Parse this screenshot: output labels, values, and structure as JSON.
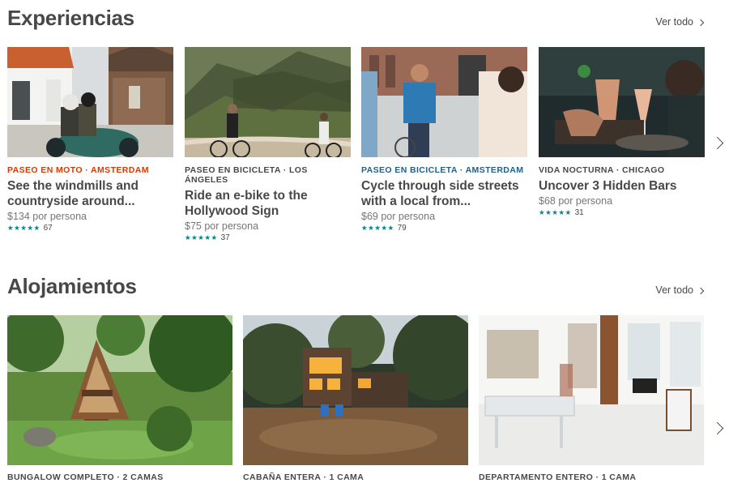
{
  "experiences": {
    "title": "Experiencias",
    "see_all": "Ver todo",
    "cards": [
      {
        "category": "PASEO EN MOTO · AMSTERDAM",
        "category_color": "#D93900",
        "title_line1": "See the windmills and",
        "title_line2": "countryside around...",
        "price": "$134 por persona",
        "stars": "★★★★★",
        "reviews": "67"
      },
      {
        "category": "PASEO EN BICICLETA · LOS ÁNGELES",
        "category_color": "#484848",
        "title_line1": "Ride an e-bike to the",
        "title_line2": "Hollywood Sign",
        "price": "$75 por persona",
        "stars": "★★★★★",
        "reviews": "37"
      },
      {
        "category": "PASEO EN BICICLETA · AMSTERDAM",
        "category_color": "#1F5F8B",
        "title_line1": "Cycle through side streets",
        "title_line2": "with a local from...",
        "price": "$69 por persona",
        "stars": "★★★★★",
        "reviews": "79"
      },
      {
        "category": "VIDA NOCTURNA · CHICAGO",
        "category_color": "#484848",
        "title_line1": "Uncover 3 Hidden Bars",
        "title_line2": "",
        "price": "$68 por persona",
        "stars": "★★★★★",
        "reviews": "31"
      }
    ]
  },
  "accommodations": {
    "title": "Alojamientos",
    "see_all": "Ver todo",
    "cards": [
      {
        "category": "BUNGALOW COMPLETO · 2 CAMAS"
      },
      {
        "category": "CABAÑA ENTERA · 1 CAMA"
      },
      {
        "category": "DEPARTAMENTO ENTERO · 1 CAMA"
      }
    ]
  },
  "icons": {
    "see_all_arrow": "chevron-right-icon",
    "carousel_next": "chevron-right-icon",
    "rating": "star-icon"
  },
  "colors": {
    "accent_teal": "#008489",
    "text": "#484848",
    "muted": "#767676"
  }
}
